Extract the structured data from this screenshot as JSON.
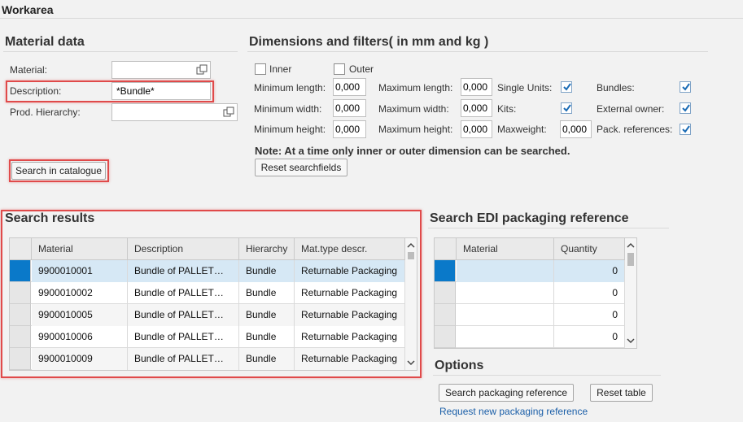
{
  "workarea": {
    "title": "Workarea"
  },
  "material_data": {
    "title": "Material data",
    "material_label": "Material:",
    "material_value": "",
    "description_label": "Description:",
    "description_value": "*Bundle*",
    "hierarchy_label": "Prod. Hierarchy:",
    "hierarchy_value": "",
    "search_button": "Search in catalogue"
  },
  "dimensions": {
    "title": "Dimensions and filters( in mm and kg )",
    "inner_label": "Inner",
    "outer_label": "Outer",
    "min_length_label": "Minimum length:",
    "min_length_value": "0,000",
    "min_width_label": "Minimum width:",
    "min_width_value": "0,000",
    "min_height_label": "Minimum height:",
    "min_height_value": "0,000",
    "max_length_label": "Maximum length:",
    "max_length_value": "0,000",
    "max_width_label": "Maximum width:",
    "max_width_value": "0,000",
    "max_height_label": "Maximum height:",
    "max_height_value": "0,000",
    "single_units_label": "Single Units:",
    "kits_label": "Kits:",
    "maxweight_label": "Maxweight:",
    "maxweight_value": "0,000",
    "bundles_label": "Bundles:",
    "external_owner_label": "External owner:",
    "pack_refs_label": "Pack. references:",
    "note": "Note: At a time only inner or outer dimension can be searched.",
    "reset_button": "Reset searchfields"
  },
  "results": {
    "title": "Search results",
    "columns": [
      "Material",
      "Description",
      "Hierarchy",
      "Mat.type descr."
    ],
    "rows": [
      {
        "material": "9900010001",
        "description": "Bundle of PALLET…",
        "hierarchy": "Bundle",
        "type": "Returnable Packaging"
      },
      {
        "material": "9900010002",
        "description": "Bundle of PALLET…",
        "hierarchy": "Bundle",
        "type": "Returnable Packaging"
      },
      {
        "material": "9900010005",
        "description": "Bundle of PALLET…",
        "hierarchy": "Bundle",
        "type": "Returnable Packaging"
      },
      {
        "material": "9900010006",
        "description": "Bundle of PALLET…",
        "hierarchy": "Bundle",
        "type": "Returnable Packaging"
      },
      {
        "material": "9900010009",
        "description": "Bundle of PALLET…",
        "hierarchy": "Bundle",
        "type": "Returnable Packaging"
      }
    ]
  },
  "edi": {
    "title": "Search EDI packaging reference",
    "columns": [
      "Material",
      "Quantity"
    ],
    "rows": [
      {
        "material": "",
        "quantity": "0"
      },
      {
        "material": "",
        "quantity": "0"
      },
      {
        "material": "",
        "quantity": "0"
      },
      {
        "material": "",
        "quantity": "0"
      }
    ]
  },
  "options": {
    "title": "Options",
    "search_ref_button": "Search packaging reference",
    "reset_table_button": "Reset table",
    "request_link": "Request new packaging reference"
  },
  "colors": {
    "accent": "#0a79c9",
    "highlight": "#e04a4a",
    "selected_row": "#d6e8f5",
    "link": "#1b5fa8"
  }
}
